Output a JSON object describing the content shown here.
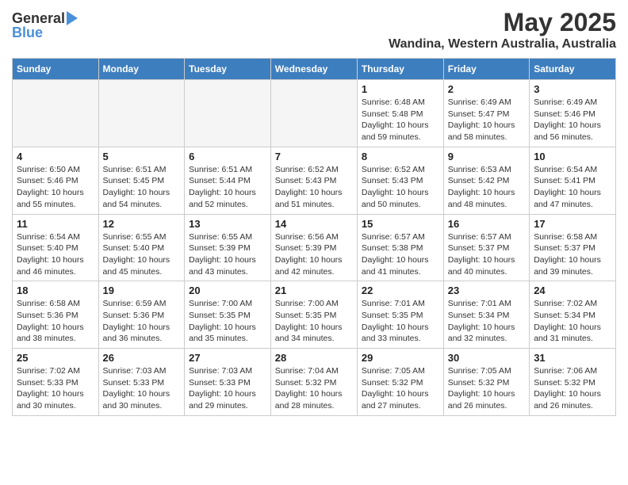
{
  "logo": {
    "general": "General",
    "blue": "Blue"
  },
  "title": "May 2025",
  "location": "Wandina, Western Australia, Australia",
  "days_of_week": [
    "Sunday",
    "Monday",
    "Tuesday",
    "Wednesday",
    "Thursday",
    "Friday",
    "Saturday"
  ],
  "weeks": [
    [
      {
        "day": "",
        "info": ""
      },
      {
        "day": "",
        "info": ""
      },
      {
        "day": "",
        "info": ""
      },
      {
        "day": "",
        "info": ""
      },
      {
        "day": "1",
        "info": "Sunrise: 6:48 AM\nSunset: 5:48 PM\nDaylight: 10 hours\nand 59 minutes."
      },
      {
        "day": "2",
        "info": "Sunrise: 6:49 AM\nSunset: 5:47 PM\nDaylight: 10 hours\nand 58 minutes."
      },
      {
        "day": "3",
        "info": "Sunrise: 6:49 AM\nSunset: 5:46 PM\nDaylight: 10 hours\nand 56 minutes."
      }
    ],
    [
      {
        "day": "4",
        "info": "Sunrise: 6:50 AM\nSunset: 5:46 PM\nDaylight: 10 hours\nand 55 minutes."
      },
      {
        "day": "5",
        "info": "Sunrise: 6:51 AM\nSunset: 5:45 PM\nDaylight: 10 hours\nand 54 minutes."
      },
      {
        "day": "6",
        "info": "Sunrise: 6:51 AM\nSunset: 5:44 PM\nDaylight: 10 hours\nand 52 minutes."
      },
      {
        "day": "7",
        "info": "Sunrise: 6:52 AM\nSunset: 5:43 PM\nDaylight: 10 hours\nand 51 minutes."
      },
      {
        "day": "8",
        "info": "Sunrise: 6:52 AM\nSunset: 5:43 PM\nDaylight: 10 hours\nand 50 minutes."
      },
      {
        "day": "9",
        "info": "Sunrise: 6:53 AM\nSunset: 5:42 PM\nDaylight: 10 hours\nand 48 minutes."
      },
      {
        "day": "10",
        "info": "Sunrise: 6:54 AM\nSunset: 5:41 PM\nDaylight: 10 hours\nand 47 minutes."
      }
    ],
    [
      {
        "day": "11",
        "info": "Sunrise: 6:54 AM\nSunset: 5:40 PM\nDaylight: 10 hours\nand 46 minutes."
      },
      {
        "day": "12",
        "info": "Sunrise: 6:55 AM\nSunset: 5:40 PM\nDaylight: 10 hours\nand 45 minutes."
      },
      {
        "day": "13",
        "info": "Sunrise: 6:55 AM\nSunset: 5:39 PM\nDaylight: 10 hours\nand 43 minutes."
      },
      {
        "day": "14",
        "info": "Sunrise: 6:56 AM\nSunset: 5:39 PM\nDaylight: 10 hours\nand 42 minutes."
      },
      {
        "day": "15",
        "info": "Sunrise: 6:57 AM\nSunset: 5:38 PM\nDaylight: 10 hours\nand 41 minutes."
      },
      {
        "day": "16",
        "info": "Sunrise: 6:57 AM\nSunset: 5:37 PM\nDaylight: 10 hours\nand 40 minutes."
      },
      {
        "day": "17",
        "info": "Sunrise: 6:58 AM\nSunset: 5:37 PM\nDaylight: 10 hours\nand 39 minutes."
      }
    ],
    [
      {
        "day": "18",
        "info": "Sunrise: 6:58 AM\nSunset: 5:36 PM\nDaylight: 10 hours\nand 38 minutes."
      },
      {
        "day": "19",
        "info": "Sunrise: 6:59 AM\nSunset: 5:36 PM\nDaylight: 10 hours\nand 36 minutes."
      },
      {
        "day": "20",
        "info": "Sunrise: 7:00 AM\nSunset: 5:35 PM\nDaylight: 10 hours\nand 35 minutes."
      },
      {
        "day": "21",
        "info": "Sunrise: 7:00 AM\nSunset: 5:35 PM\nDaylight: 10 hours\nand 34 minutes."
      },
      {
        "day": "22",
        "info": "Sunrise: 7:01 AM\nSunset: 5:35 PM\nDaylight: 10 hours\nand 33 minutes."
      },
      {
        "day": "23",
        "info": "Sunrise: 7:01 AM\nSunset: 5:34 PM\nDaylight: 10 hours\nand 32 minutes."
      },
      {
        "day": "24",
        "info": "Sunrise: 7:02 AM\nSunset: 5:34 PM\nDaylight: 10 hours\nand 31 minutes."
      }
    ],
    [
      {
        "day": "25",
        "info": "Sunrise: 7:02 AM\nSunset: 5:33 PM\nDaylight: 10 hours\nand 30 minutes."
      },
      {
        "day": "26",
        "info": "Sunrise: 7:03 AM\nSunset: 5:33 PM\nDaylight: 10 hours\nand 30 minutes."
      },
      {
        "day": "27",
        "info": "Sunrise: 7:03 AM\nSunset: 5:33 PM\nDaylight: 10 hours\nand 29 minutes."
      },
      {
        "day": "28",
        "info": "Sunrise: 7:04 AM\nSunset: 5:32 PM\nDaylight: 10 hours\nand 28 minutes."
      },
      {
        "day": "29",
        "info": "Sunrise: 7:05 AM\nSunset: 5:32 PM\nDaylight: 10 hours\nand 27 minutes."
      },
      {
        "day": "30",
        "info": "Sunrise: 7:05 AM\nSunset: 5:32 PM\nDaylight: 10 hours\nand 26 minutes."
      },
      {
        "day": "31",
        "info": "Sunrise: 7:06 AM\nSunset: 5:32 PM\nDaylight: 10 hours\nand 26 minutes."
      }
    ]
  ]
}
